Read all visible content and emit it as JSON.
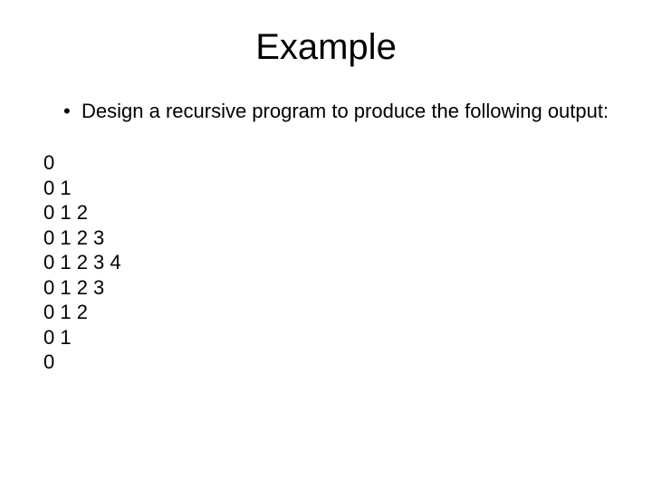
{
  "title": "Example",
  "bullet": "Design a recursive program to produce the following output:",
  "output": {
    "line0": "0",
    "line1": "0 1",
    "line2": "0 1 2",
    "line3": "0 1 2 3",
    "line4": "0 1 2 3 4",
    "line5": "0 1 2 3",
    "line6": "0 1 2",
    "line7": "0 1",
    "line8": "0"
  }
}
